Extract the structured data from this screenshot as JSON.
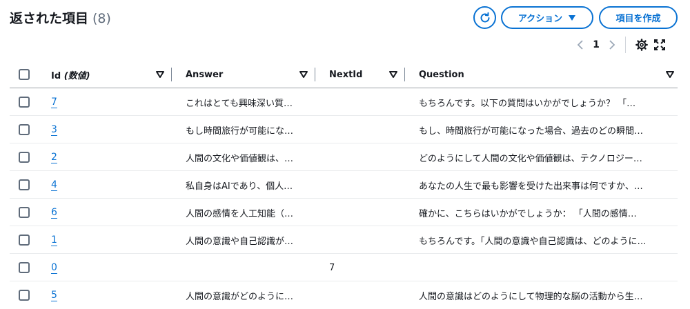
{
  "header": {
    "title": "返された項目",
    "count": "(8)",
    "actions_label": "アクション",
    "create_label": "項目を作成"
  },
  "pagination": {
    "current_page": "1"
  },
  "columns": {
    "id_label": "Id",
    "id_type": "(数値)",
    "answer": "Answer",
    "nextid": "NextId",
    "question": "Question"
  },
  "rows": [
    {
      "id": "7",
      "answer": "これはとても興味深い質…",
      "nextid": "",
      "question": "もちろんです。以下の質問はいかがでしょうか？ 「…"
    },
    {
      "id": "3",
      "answer": "もし時間旅行が可能にな…",
      "nextid": "",
      "question": "もし、時間旅行が可能になった場合、過去のどの瞬間…"
    },
    {
      "id": "2",
      "answer": "人間の文化や価値観は、…",
      "nextid": "",
      "question": "どのようにして人間の文化や価値観は、テクノロジー…"
    },
    {
      "id": "4",
      "answer": "私自身はAIであり、個人…",
      "nextid": "",
      "question": "あなたの人生で最も影響を受けた出来事は何ですか、…"
    },
    {
      "id": "6",
      "answer": "人間の感情を人工知能（…",
      "nextid": "",
      "question": "確かに、こちらはいかがでしょうか： 「人間の感情…"
    },
    {
      "id": "1",
      "answer": "人間の意識や自己認識が…",
      "nextid": "",
      "question": "もちろんです。｢人間の意識や自己認識は、どのように…"
    },
    {
      "id": "0",
      "answer": "",
      "nextid": "7",
      "question": ""
    },
    {
      "id": "5",
      "answer": "人間の意識がどのように…",
      "nextid": "",
      "question": "人間の意識はどのようにして物理的な脳の活動から生…"
    }
  ],
  "colors": {
    "accent": "#0972d3",
    "text": "#16191f",
    "muted": "#5f6b7a"
  }
}
